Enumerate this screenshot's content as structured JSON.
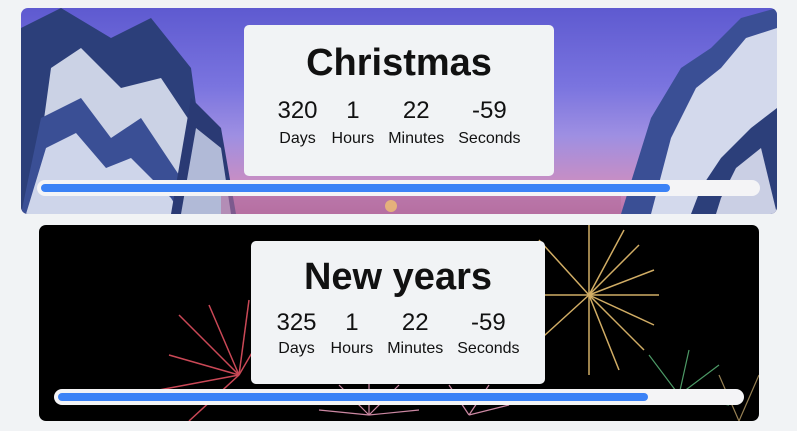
{
  "countdowns": [
    {
      "title": "Christmas",
      "units": [
        {
          "value": "320",
          "label": "Days"
        },
        {
          "value": "1",
          "label": "Hours"
        },
        {
          "value": "22",
          "label": "Minutes"
        },
        {
          "value": "-59",
          "label": "Seconds"
        }
      ],
      "progress": 0.88,
      "background": "snowy-forest-sunset",
      "bar_color": "#3b82f6"
    },
    {
      "title": "New years",
      "units": [
        {
          "value": "325",
          "label": "Days"
        },
        {
          "value": "1",
          "label": "Hours"
        },
        {
          "value": "22",
          "label": "Minutes"
        },
        {
          "value": "-59",
          "label": "Seconds"
        }
      ],
      "progress": 0.865,
      "background": "fireworks-night",
      "bar_color": "#3b82f6"
    }
  ]
}
